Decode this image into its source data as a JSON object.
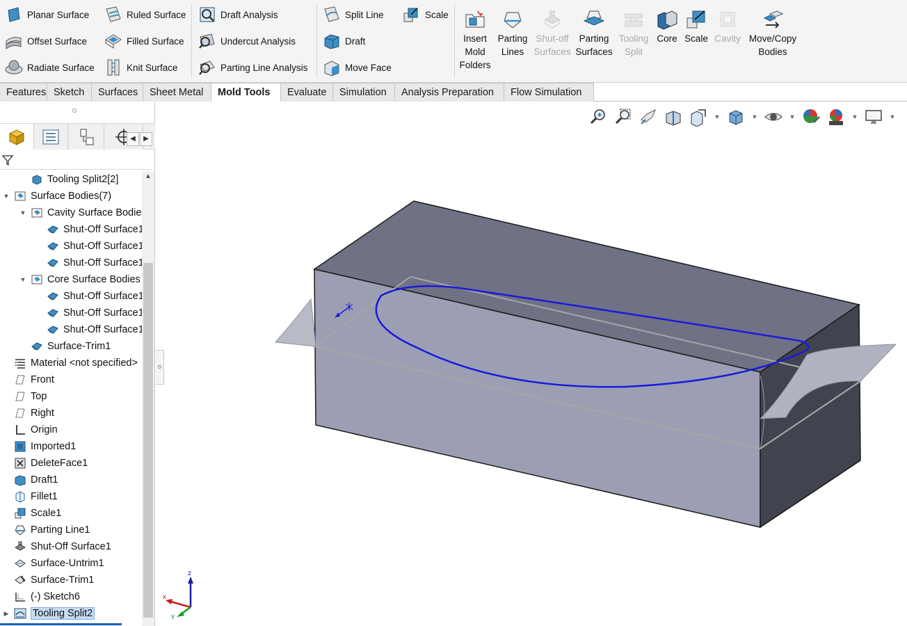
{
  "ribbon": {
    "groups": [
      {
        "items": [
          "Planar Surface",
          "Offset Surface",
          "Radiate Surface"
        ]
      },
      {
        "items": [
          "Ruled Surface",
          "Filled Surface",
          "Knit Surface"
        ]
      },
      {
        "items": [
          "Draft Analysis",
          "Undercut Analysis",
          "Parting Line Analysis"
        ]
      },
      {
        "items": [
          "Split Line",
          "Draft",
          "Move Face"
        ]
      },
      {
        "items": [
          "Scale"
        ]
      }
    ],
    "large_buttons": [
      {
        "label": "Insert Mold Folders",
        "enabled": true
      },
      {
        "label": "Parting Lines",
        "enabled": true
      },
      {
        "label": "Shut-off Surfaces",
        "enabled": false
      },
      {
        "label": "Parting Surfaces",
        "enabled": true
      },
      {
        "label": "Tooling Split",
        "enabled": false
      },
      {
        "label": "Core",
        "enabled": true
      },
      {
        "label": "Scale",
        "enabled": true
      },
      {
        "label": "Cavity",
        "enabled": false
      },
      {
        "label": "Move/Copy Bodies",
        "enabled": true
      }
    ]
  },
  "tabs": [
    "Features",
    "Sketch",
    "Surfaces",
    "Sheet Metal",
    "Mold Tools",
    "Evaluate",
    "Simulation",
    "Analysis Preparation",
    "Flow Simulation"
  ],
  "active_tab": "Mold Tools",
  "tree": [
    {
      "label": "Tooling Split2[2]",
      "icon": "solid-body-icon",
      "level": 2
    },
    {
      "label": "Surface Bodies(7)",
      "icon": "surface-folder-icon",
      "level": 1,
      "expanded": true
    },
    {
      "label": "Cavity Surface Bodies",
      "icon": "surface-folder-icon",
      "level": 2,
      "expanded": true
    },
    {
      "label": "Shut-Off Surface1",
      "icon": "surface-body-icon",
      "level": 3
    },
    {
      "label": "Shut-Off Surface1",
      "icon": "surface-body-icon",
      "level": 3
    },
    {
      "label": "Shut-Off Surface1",
      "icon": "surface-body-icon",
      "level": 3
    },
    {
      "label": "Core Surface Bodies",
      "icon": "surface-folder-icon",
      "level": 2,
      "expanded": true
    },
    {
      "label": "Shut-Off Surface1",
      "icon": "surface-body-icon",
      "level": 3
    },
    {
      "label": "Shut-Off Surface1",
      "icon": "surface-body-icon",
      "level": 3
    },
    {
      "label": "Shut-Off Surface1",
      "icon": "surface-body-icon",
      "level": 3
    },
    {
      "label": "Surface-Trim1",
      "icon": "surface-body-icon",
      "level": 2
    },
    {
      "label": "Material <not specified>",
      "icon": "material-icon",
      "level": 1
    },
    {
      "label": "Front",
      "icon": "plane-icon",
      "level": 1
    },
    {
      "label": "Top",
      "icon": "plane-icon",
      "level": 1
    },
    {
      "label": "Right",
      "icon": "plane-icon",
      "level": 1
    },
    {
      "label": "Origin",
      "icon": "origin-icon",
      "level": 1
    },
    {
      "label": "Imported1",
      "icon": "imported-icon",
      "level": 1
    },
    {
      "label": "DeleteFace1",
      "icon": "delete-face-icon",
      "level": 1
    },
    {
      "label": "Draft1",
      "icon": "draft-icon",
      "level": 1
    },
    {
      "label": "Fillet1",
      "icon": "fillet-icon",
      "level": 1
    },
    {
      "label": "Scale1",
      "icon": "scale-icon",
      "level": 1
    },
    {
      "label": "Parting Line1",
      "icon": "parting-line-icon",
      "level": 1
    },
    {
      "label": "Shut-Off Surface1",
      "icon": "shutoff-icon",
      "level": 1
    },
    {
      "label": "Surface-Untrim1",
      "icon": "untrim-icon",
      "level": 1
    },
    {
      "label": "Surface-Trim1",
      "icon": "trim-icon",
      "level": 1
    },
    {
      "label": "(-) Sketch6",
      "icon": "sketch-icon",
      "level": 1
    },
    {
      "label": "Tooling Split2",
      "icon": "tooling-split-icon",
      "level": 1,
      "selected": true,
      "collapsed": true
    }
  ],
  "triad": {
    "x": "x",
    "y": "y",
    "z": "z"
  },
  "colors": {
    "accent": "#1b5fb8",
    "parting_line": "#1a1adc",
    "body_front": "#9c9fb3",
    "body_top": "#6f7184",
    "body_side": "#41434f"
  }
}
